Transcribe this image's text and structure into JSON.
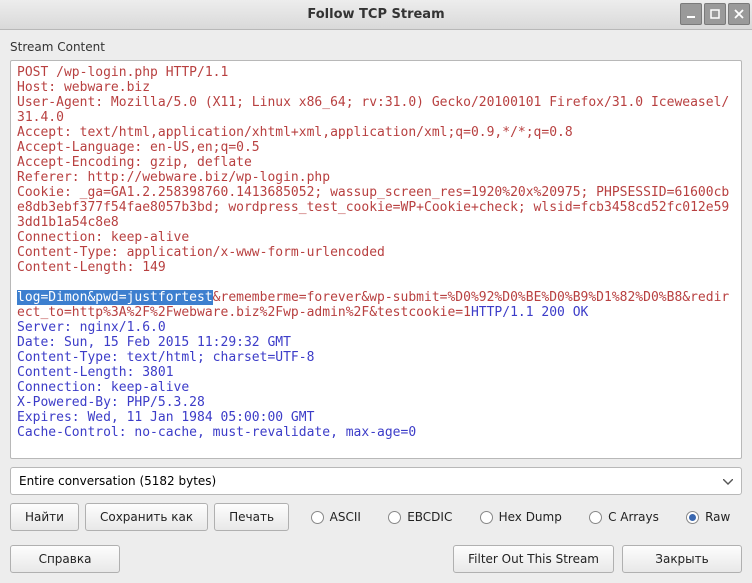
{
  "window": {
    "title": "Follow TCP Stream"
  },
  "section_label": "Stream Content",
  "stream": {
    "request": "POST /wp-login.php HTTP/1.1\nHost: webware.biz\nUser-Agent: Mozilla/5.0 (X11; Linux x86_64; rv:31.0) Gecko/20100101 Firefox/31.0 Iceweasel/31.4.0\nAccept: text/html,application/xhtml+xml,application/xml;q=0.9,*/*;q=0.8\nAccept-Language: en-US,en;q=0.5\nAccept-Encoding: gzip, deflate\nReferer: http://webware.biz/wp-login.php\nCookie: _ga=GA1.2.258398760.1413685052; wassup_screen_res=1920%20x%20975; PHPSESSID=61600cbe8db3ebf377f54fae8057b3bd; wordpress_test_cookie=WP+Cookie+check; wlsid=fcb3458cd52fc012e593dd1b1a54c8e8\nConnection: keep-alive\nContent-Type: application/x-www-form-urlencoded\nContent-Length: 149\n\n",
    "selected": "log=Dimon&pwd=justfortest",
    "request_tail": "&rememberme=forever&wp-submit=%D0%92%D0%BE%D0%B9%D1%82%D0%B8&redirect_to=http%3A%2F%2Fwebware.biz%2Fwp-admin%2F&testcookie=1",
    "response": "HTTP/1.1 200 OK\nServer: nginx/1.6.0\nDate: Sun, 15 Feb 2015 11:29:32 GMT\nContent-Type: text/html; charset=UTF-8\nContent-Length: 3801\nConnection: keep-alive\nX-Powered-By: PHP/5.3.28\nExpires: Wed, 11 Jan 1984 05:00:00 GMT\nCache-Control: no-cache, must-revalidate, max-age=0"
  },
  "dropdown": {
    "selected": "Entire conversation (5182 bytes)"
  },
  "buttons": {
    "find": "Найти",
    "save_as": "Сохранить как",
    "print": "Печать",
    "help": "Справка",
    "filter_out": "Filter Out This Stream",
    "close": "Закрыть"
  },
  "format_options": {
    "ascii": "ASCII",
    "ebcdic": "EBCDIC",
    "hexdump": "Hex Dump",
    "carrays": "C Arrays",
    "raw": "Raw",
    "selected": "raw"
  }
}
